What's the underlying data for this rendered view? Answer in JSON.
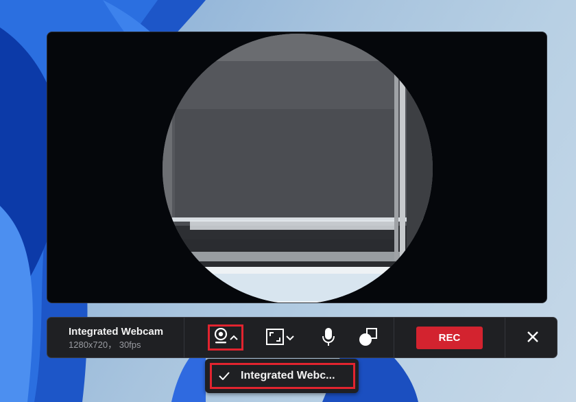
{
  "webcam": {
    "name": "Integrated Webcam",
    "resolution": "1280x720， 30fps"
  },
  "toolbar": {
    "rec_label": "REC",
    "icons": [
      "webcam-icon",
      "chevron-up-icon",
      "layout-icon",
      "chevron-down-icon",
      "microphone-icon",
      "shape-icon",
      "close-icon"
    ]
  },
  "dropdown": {
    "selected": "Integrated Webc..."
  },
  "colors": {
    "accent_red": "#d3232f",
    "highlight_red": "#e2242f",
    "toolbar_bg": "#1f2023"
  }
}
